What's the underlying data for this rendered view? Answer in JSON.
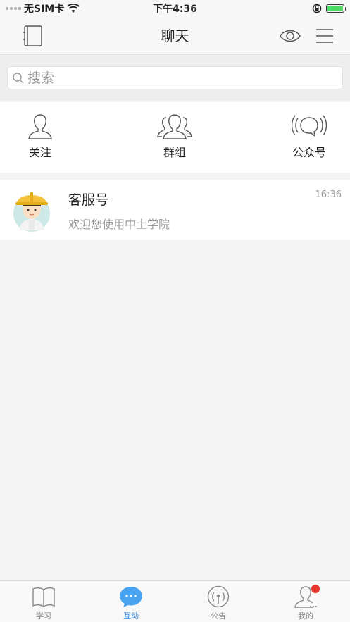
{
  "status_bar": {
    "carrier": "无SIM卡",
    "time": "下午4:36"
  },
  "nav": {
    "title": "聊天"
  },
  "search": {
    "placeholder": "搜索"
  },
  "quick_actions": [
    {
      "label": "关注",
      "icon": "person-icon"
    },
    {
      "label": "群组",
      "icon": "group-icon"
    },
    {
      "label": "公众号",
      "icon": "broadcast-chat-icon"
    }
  ],
  "conversations": [
    {
      "name": "客服号",
      "preview": "欢迎您使用中土学院",
      "time": "16:36"
    }
  ],
  "tabs": [
    {
      "label": "学习",
      "icon": "book-icon",
      "active": false
    },
    {
      "label": "互动",
      "icon": "chat-bubble-icon",
      "active": true
    },
    {
      "label": "公告",
      "icon": "broadcast-icon",
      "active": false
    },
    {
      "label": "我的",
      "icon": "profile-icon",
      "active": false,
      "badge": true
    }
  ],
  "colors": {
    "accent": "#3a8ee6",
    "badge": "#e8382f",
    "background": "#f4f4f4"
  }
}
